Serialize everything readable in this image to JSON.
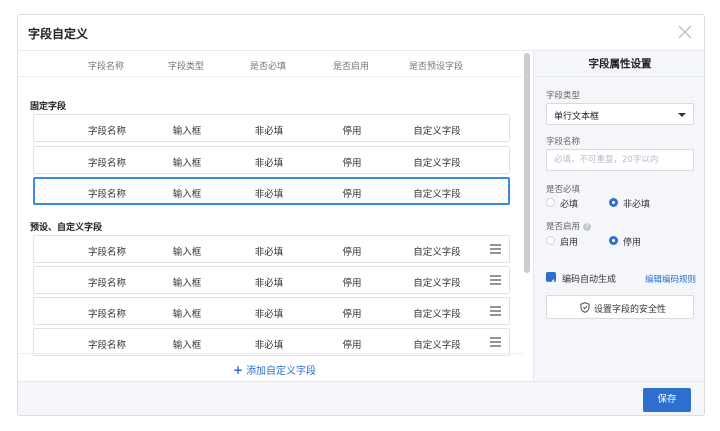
{
  "dialog": {
    "title": "字段自定义",
    "save_label": "保存"
  },
  "columns": [
    "字段名称",
    "字段类型",
    "是否必填",
    "是否启用",
    "是否预设字段"
  ],
  "fixed_section": {
    "label": "固定字段",
    "rows": [
      [
        "字段名称",
        "输入框",
        "非必填",
        "停用",
        "自定义字段"
      ],
      [
        "字段名称",
        "输入框",
        "非必填",
        "停用",
        "自定义字段"
      ],
      [
        "字段名称",
        "输入框",
        "非必填",
        "停用",
        "自定义字段"
      ]
    ]
  },
  "custom_section": {
    "label": "预设、自定义字段",
    "rows": [
      [
        "字段名称",
        "输入框",
        "非必填",
        "停用",
        "自定义字段"
      ],
      [
        "字段名称",
        "输入框",
        "非必填",
        "停用",
        "自定义字段"
      ],
      [
        "字段名称",
        "输入框",
        "非必填",
        "停用",
        "自定义字段"
      ],
      [
        "字段名称",
        "输入框",
        "非必填",
        "停用",
        "自定义字段"
      ]
    ]
  },
  "add_field_label": "添加自定义字段",
  "panel": {
    "title": "字段属性设置",
    "type_label": "字段类型",
    "type_value": "单行文本框",
    "name_label": "字段名称",
    "name_placeholder": "必填，不可重复，20字以内",
    "required_label": "是否必填",
    "required_options": [
      "必填",
      "非必填"
    ],
    "required_selected": "非必填",
    "enabled_label": "是否启用",
    "enabled_options": [
      "启用",
      "停用"
    ],
    "enabled_selected": "停用",
    "auto_code_label": "编码自动生成",
    "auto_code_checked": true,
    "edit_rule_link": "编辑编码规则",
    "security_button": "设置字段的安全性"
  },
  "colors": {
    "accent": "#2c6fd1",
    "selected_border": "#3d8be0"
  }
}
